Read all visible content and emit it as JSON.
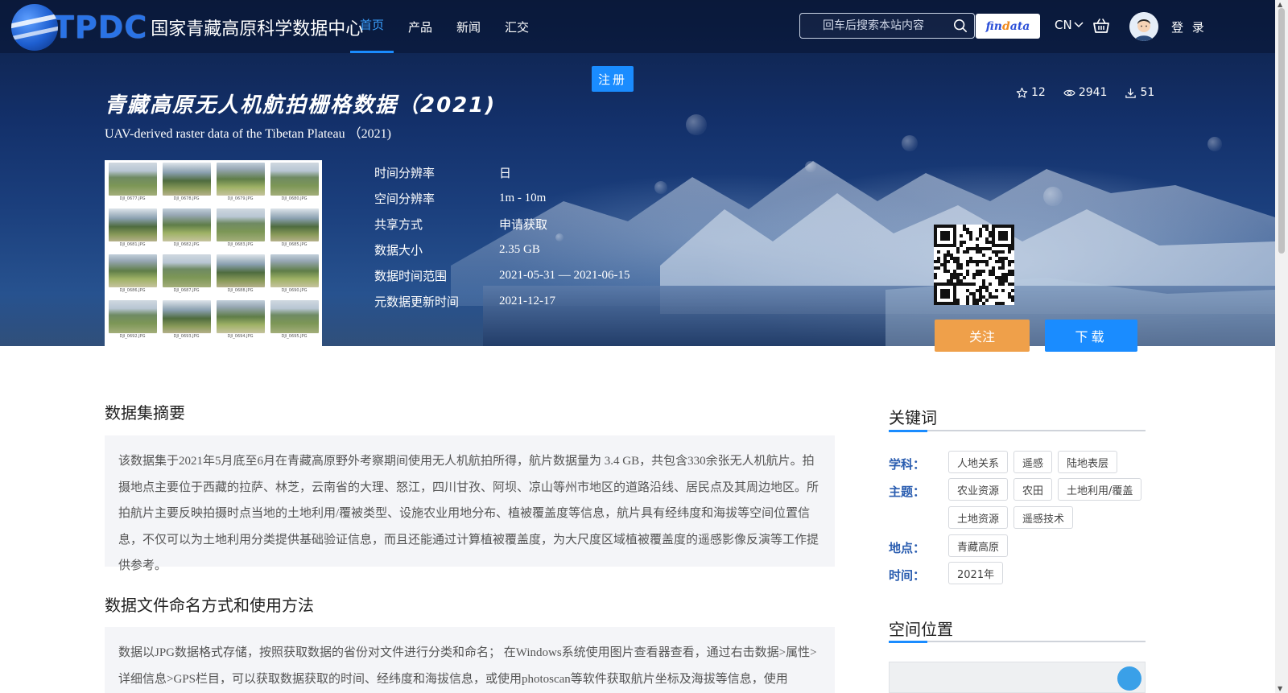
{
  "brand": {
    "abbr": "TPDC",
    "name": "国家青藏高原科学数据中心"
  },
  "nav": {
    "items": [
      "首页",
      "产品",
      "新闻",
      "汇交"
    ],
    "active_index": 0
  },
  "search": {
    "placeholder": "回车后搜索本站内容"
  },
  "findata": {
    "brand_left": "fin",
    "brand_accent": "d",
    "brand_right": "ata"
  },
  "lang": "CN",
  "login_label": "登 录",
  "register_label": "注册",
  "dataset": {
    "title_zh": "青藏高原无人机航拍栅格数据（2021)",
    "title_en": "UAV-derived raster data of the Tibetan Plateau （2021)",
    "stats": {
      "stars": "12",
      "views": "2941",
      "downloads": "51"
    },
    "meta": [
      {
        "key": "时间分辨率",
        "value": "日"
      },
      {
        "key": "空间分辨率",
        "value": "1m - 10m"
      },
      {
        "key": "共享方式",
        "value": "申请获取"
      },
      {
        "key": "数据大小",
        "value": "2.35 GB"
      },
      {
        "key": "数据时间范围",
        "value": "2021-05-31 — 2021-06-15"
      },
      {
        "key": "元数据更新时间",
        "value": "2021-12-17"
      }
    ],
    "thumbnails": [
      "DJI_0677.JPG",
      "DJI_0678.JPG",
      "DJI_0679.JPG",
      "DJI_0680.JPG",
      "DJI_0681.JPG",
      "DJI_0682.JPG",
      "DJI_0683.JPG",
      "DJI_0685.JPG",
      "DJI_0686.JPG",
      "DJI_0687.JPG",
      "DJI_0688.JPG",
      "DJI_0690.JPG",
      "DJI_0692.JPG",
      "DJI_0693.JPG",
      "DJI_0694.JPG",
      "DJI_0695.JPG"
    ],
    "follow_label": "关注",
    "download_label": "下载"
  },
  "abstract": {
    "title": "数据集摘要",
    "text": "该数据集于2021年5月底至6月在青藏高原野外考察期间使用无人机航拍所得，航片数据量为 3.4 GB，共包含330余张无人机航片。拍摄地点主要位于西藏的拉萨、林芝，云南省的大理、怒江，四川甘孜、阿坝、凉山等州市地区的道路沿线、居民点及其周边地区。所拍航片主要反映拍摄时点当地的土地利用/覆被类型、设施农业用地分布、植被覆盖度等信息，航片具有经纬度和海拔等空间位置信息，不仅可以为土地利用分类提供基础验证信息，而且还能通过计算植被覆盖度，为大尺度区域植被覆盖度的遥感影像反演等工作提供参考。"
  },
  "naming": {
    "title": "数据文件命名方式和使用方法",
    "text": "数据以JPG数据格式存储，按照获取数据的省份对文件进行分类和命名； 在Windows系统使用图片查看器查看，通过右击数据>属性>详细信息>GPS栏目，可以获取数据获取的时间、经纬度和海拔信息，或使用photoscan等软件获取航片坐标及海拔等信息，使用photoshop"
  },
  "keywords": {
    "title": "关键词",
    "groups": [
      {
        "label": "学科：",
        "tags": [
          "人地关系",
          "遥感",
          "陆地表层"
        ]
      },
      {
        "label": "主题：",
        "tags": [
          "农业资源",
          "农田",
          "土地利用/覆盖",
          "土地资源",
          "遥感技术"
        ]
      },
      {
        "label": "地点：",
        "tags": [
          "青藏高原"
        ]
      },
      {
        "label": "时间：",
        "tags": [
          "2021年"
        ]
      }
    ]
  },
  "location": {
    "title": "空间位置"
  },
  "colors": {
    "accent": "#1a8cff",
    "follow": "#efa04a",
    "keyword_label": "#2a5db0"
  }
}
